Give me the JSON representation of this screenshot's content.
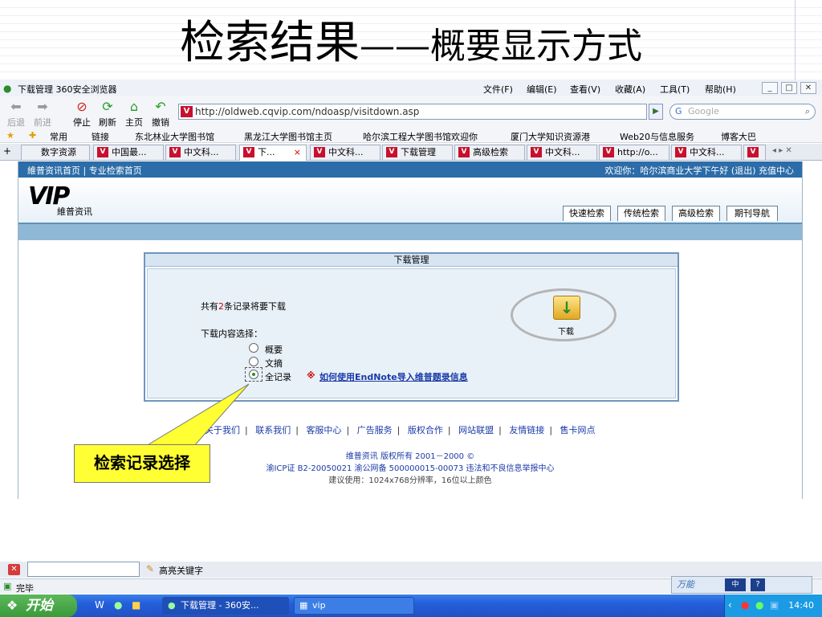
{
  "slide": {
    "title_main": "检索结果",
    "title_dash": "——",
    "title_sub": "概要显示方式"
  },
  "browser": {
    "window_title": "下载管理 360安全浏览器",
    "menus": [
      "文件(F)",
      "编辑(E)",
      "查看(V)",
      "收藏(A)",
      "工具(T)",
      "帮助(H)"
    ],
    "toolbar": {
      "back": "后退",
      "forward": "前进",
      "stop": "停止",
      "refresh": "刷新",
      "home": "主页",
      "undo": "撤销"
    },
    "address": "http://oldweb.cqvip.com/ndoasp/visitdown.asp",
    "search_placeholder": "Google",
    "favorites": [
      "常用",
      "链接",
      "东北林业大学图书馆",
      "黑龙江大学图书馆主页",
      "哈尔滨工程大学图书馆欢迎你",
      "厦门大学知识资源港",
      "Web20与信息服务",
      "博客大巴"
    ],
    "tabs": [
      "数字资源",
      "中国最...",
      "中文科...",
      "下...",
      "中文科...",
      "下载管理",
      "高级检索",
      "中文科...",
      "http://o...",
      "中文科..."
    ]
  },
  "page": {
    "topnav_left": "維普资讯首页 | 专业检索首页",
    "topnav_right": "欢迎你：哈尔滨商业大学下午好 (退出) 充值中心",
    "logo_text": "VIP",
    "logo_sub": "維普资讯",
    "nav_tabs": [
      "快速检索",
      "传统检索",
      "高级检索",
      "期刊导航"
    ],
    "panel_title": "下载管理",
    "record_prefix": "共有",
    "record_count": "2",
    "record_suffix": "条记录将要下载",
    "content_label": "下载内容选择：",
    "options": [
      "概要",
      "文摘",
      "全记录"
    ],
    "selected_option": "全记录",
    "note_mark": "※",
    "endnote_link": "如何使用EndNote导入维普题录信息",
    "download_label": "下载",
    "footer_links": [
      "关于我们",
      "联系我们",
      "客服中心",
      "广告服务",
      "版权合作",
      "网站联盟",
      "友情链接",
      "售卡网点"
    ],
    "copyright": "维普资讯 版权所有 2001－2000 ©",
    "icp": "渝ICP证 B2-20050021  渝公网备 500000015-00073  违法和不良信息举报中心",
    "resolution_note": "建议使用：1024x768分辨率，16位以上颜色"
  },
  "callout": {
    "text": "检索记录选择"
  },
  "findbar": {
    "label": "高亮关键字"
  },
  "status": {
    "text": "完毕"
  },
  "taskbar": {
    "start": "开始",
    "tasks": [
      "下载管理 - 360安...",
      "vip"
    ],
    "clock": "14:40"
  },
  "colors": {
    "topnav": "#2c6ca8",
    "panel_border": "#6f96bd",
    "callout": "#ffff33",
    "link": "#1a3aa8"
  }
}
